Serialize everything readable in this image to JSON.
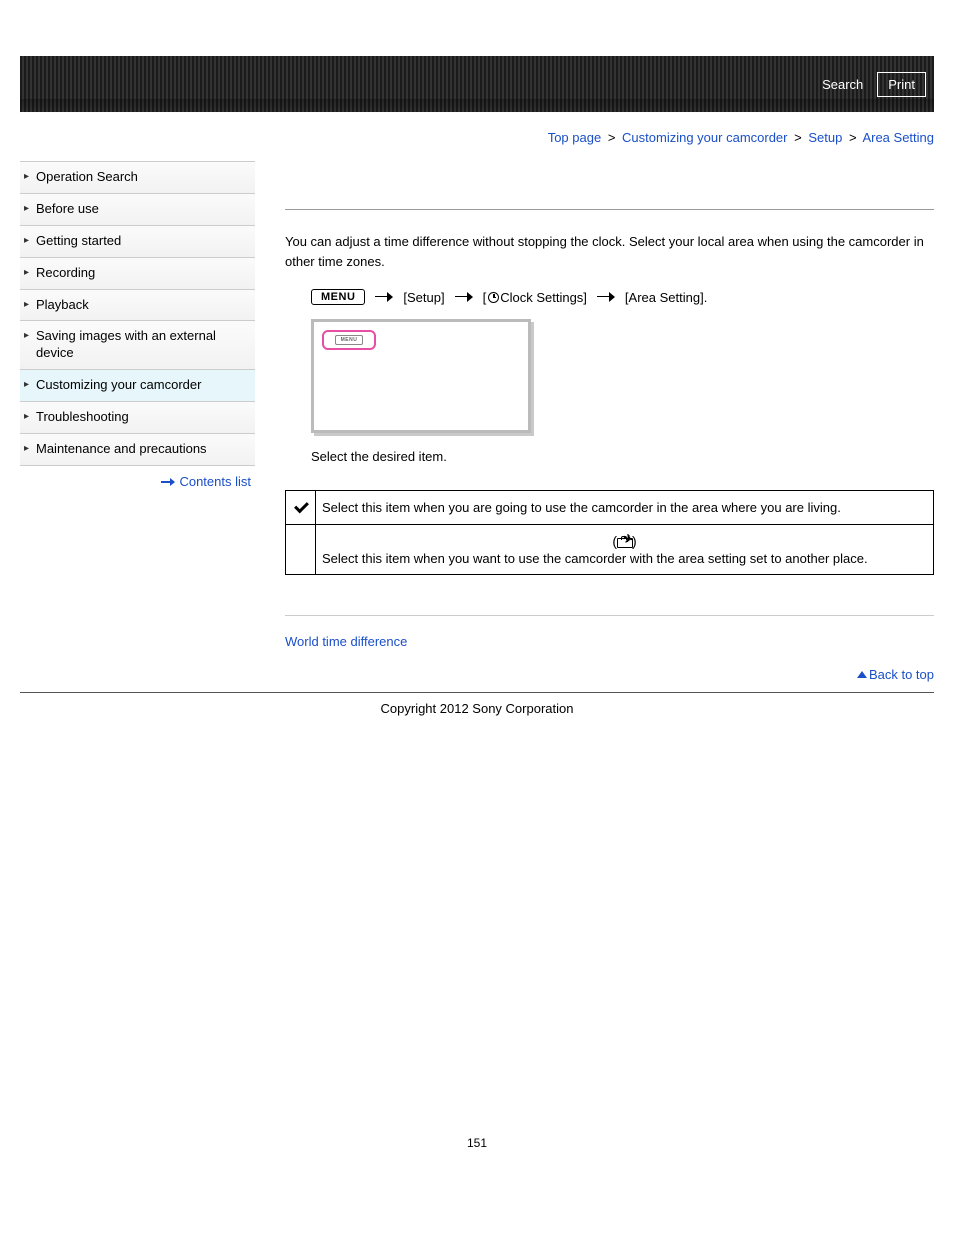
{
  "header": {
    "search_label": "Search",
    "print_label": "Print"
  },
  "breadcrumb": {
    "items": [
      "Top page",
      "Customizing your camcorder",
      "Setup",
      "Area Setting"
    ],
    "sep": ">"
  },
  "sidebar": {
    "items": [
      "Operation Search",
      "Before use",
      "Getting started",
      "Recording",
      "Playback",
      "Saving images with an external device",
      "Customizing your camcorder",
      "Troubleshooting",
      "Maintenance and precautions"
    ],
    "active_index": 6,
    "contents_list_label": "Contents list"
  },
  "main": {
    "intro": "You can adjust a time difference without stopping the clock. Select your local area when using the camcorder in other time zones.",
    "menu_path": {
      "menu_chip": "MENU",
      "steps": [
        "[Setup]",
        "[",
        "Clock Settings]",
        "[Area Setting]."
      ]
    },
    "menu_inner_label": "MENU",
    "instruction": "Select the desired item.",
    "table": {
      "rows": [
        {
          "icon": "check",
          "text": "Select this item when you are going to use the camcorder in the area where you are living."
        },
        {
          "icon": "destination",
          "dest_paren_open": "(",
          "dest_paren_close": ")",
          "text": "Select this item when you want to use the camcorder with the area setting set to another place."
        }
      ]
    },
    "related_link": "World time difference",
    "back_to_top": "Back to top"
  },
  "footer": {
    "copyright": "Copyright 2012 Sony Corporation",
    "page_number": "151"
  }
}
